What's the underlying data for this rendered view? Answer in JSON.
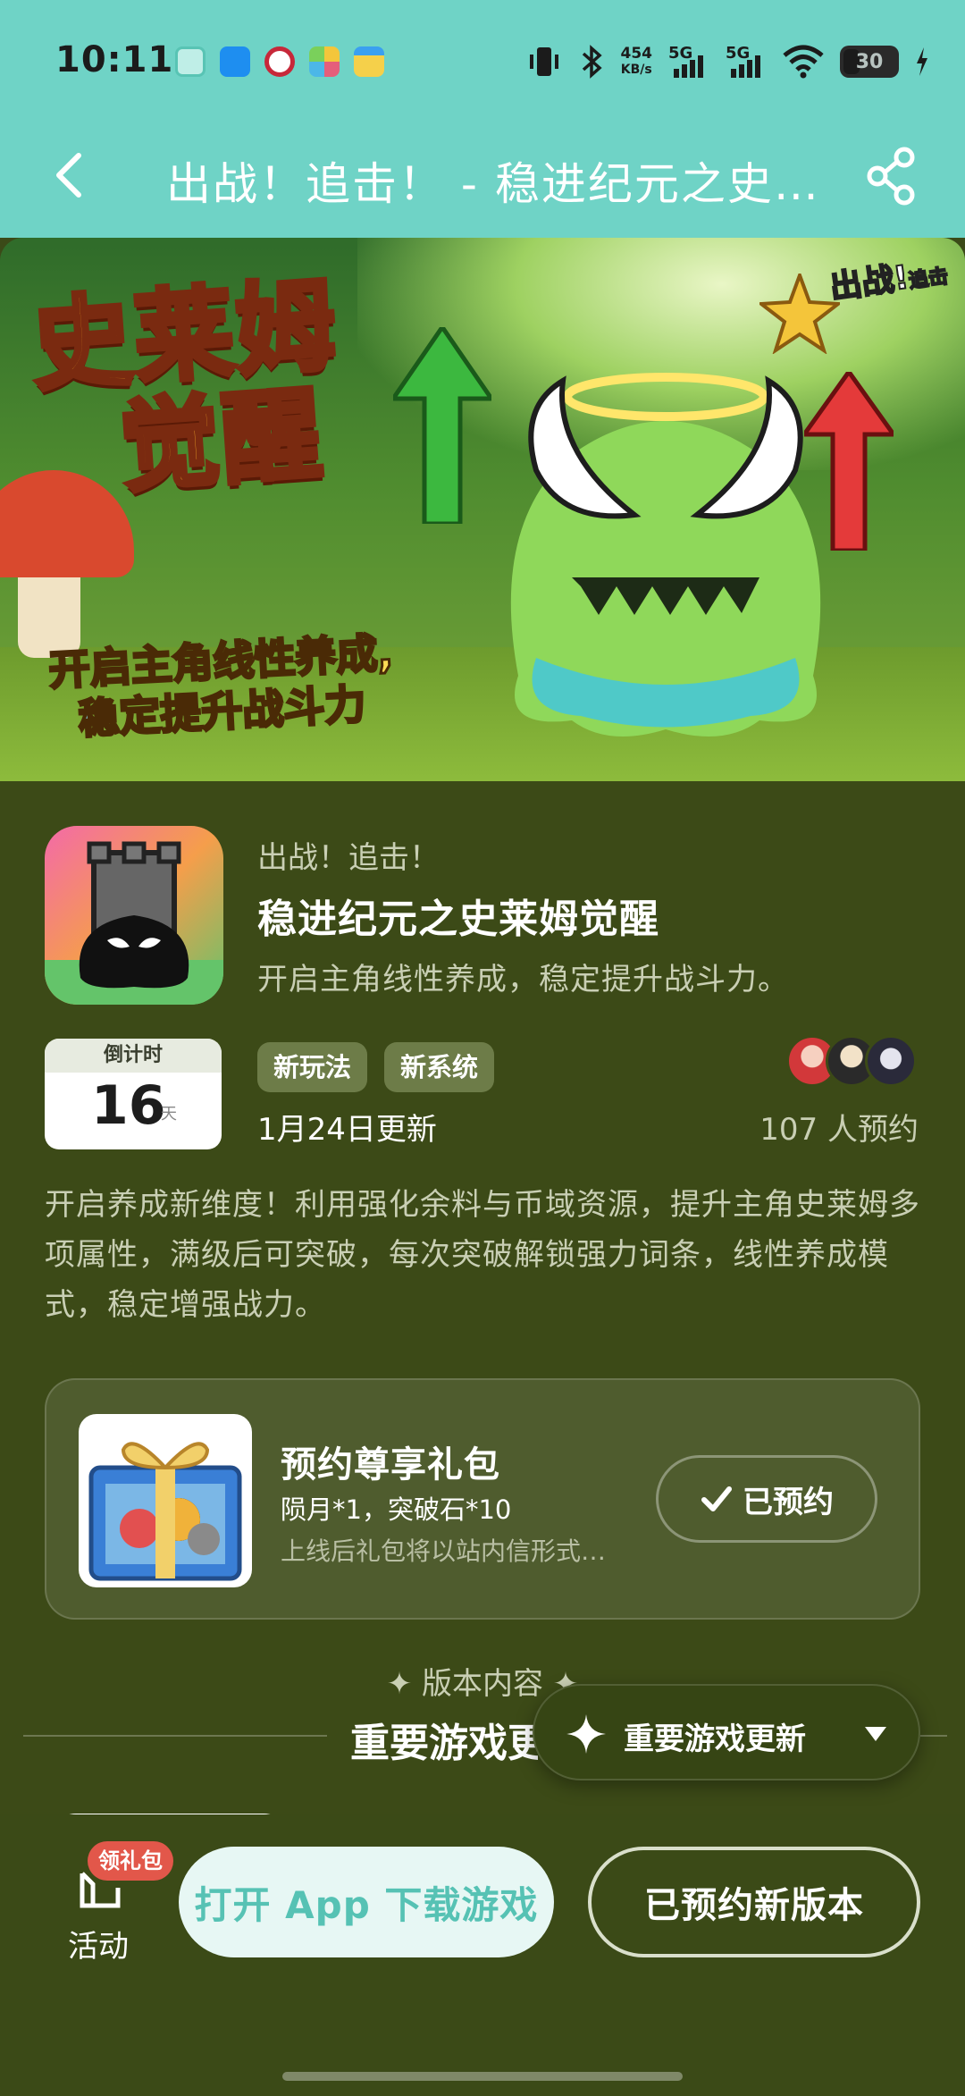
{
  "status_bar": {
    "time": "10:11",
    "net_speed_value": "454",
    "net_speed_unit": "KB/s",
    "sim1": "5G",
    "sim2": "5G",
    "battery": "30"
  },
  "header": {
    "title": "出战！追击！ - 稳进纪元之史莱姆觉醒"
  },
  "banner": {
    "title_line1": "史莱姆",
    "title_line2": "觉醒",
    "subtitle_line1": "开启主角线性养成,",
    "subtitle_line2": "稳定提升战斗力",
    "logo_line1": "出战!",
    "logo_line2": "追击"
  },
  "app": {
    "game_name": "出战！追击！",
    "version_name": "稳进纪元之史莱姆觉醒",
    "tagline": "开启主角线性养成，稳定提升战斗力。"
  },
  "countdown": {
    "label": "倒计时",
    "days": "16",
    "unit": "天"
  },
  "tags": [
    "新玩法",
    "新系统"
  ],
  "update_date": "1月24日更新",
  "reservation_count": "107 人预约",
  "description": "开启养成新维度！利用强化余料与币域资源，提升主角史莱姆多项属性，满级后可突破，每次突破解锁强力词条，线性养成模式，稳定增强战力。",
  "gift": {
    "title": "预约尊享礼包",
    "items": "陨月*1，突破石*10",
    "note": "上线后礼包将以站内信形式发放",
    "button": "已预约"
  },
  "version_section": {
    "caption": "✦ 版本内容 ✦",
    "title": "重要游戏更新"
  },
  "floating_selector": {
    "label": "重要游戏更新"
  },
  "bottom": {
    "activity_badge": "领礼包",
    "activity_label": "活动",
    "open_app": "打开 App 下载游戏",
    "reserved_version": "已预约新版本"
  },
  "colors": {
    "header_bg": "#6fd3c6",
    "page_bg": "#3c4a17",
    "accent_teal": "#56c2b4",
    "badge_red": "#e2574a"
  }
}
